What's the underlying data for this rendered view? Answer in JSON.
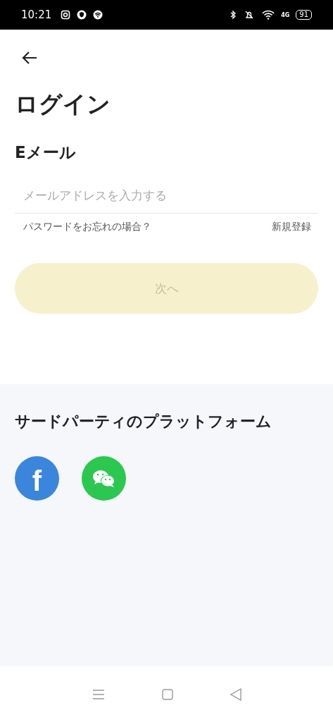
{
  "status_bar": {
    "time": "10:21",
    "network": "4G",
    "battery": "91"
  },
  "title": "ログイン",
  "email_label": "Eメール",
  "email_field": {
    "placeholder": "メールアドレスを入力する"
  },
  "forgot_link": "パスワードをお忘れの場合？",
  "register_link": "新規登録",
  "next_button": {
    "label": "次へ",
    "disabled": true
  },
  "third_party": {
    "heading": "サードパーティのプラットフォーム",
    "providers": [
      {
        "kind": "facebook",
        "mark": "f",
        "color": "#3a86dc"
      },
      {
        "kind": "wechat",
        "color": "#2ac84f"
      }
    ]
  }
}
